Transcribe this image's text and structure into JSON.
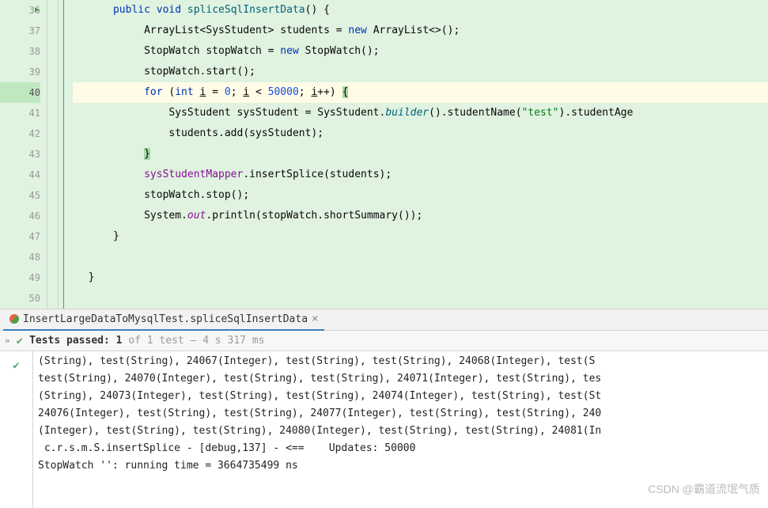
{
  "editor": {
    "lines": [
      {
        "n": 36,
        "play": true
      },
      {
        "n": 37
      },
      {
        "n": 38
      },
      {
        "n": 39
      },
      {
        "n": 40,
        "current": true
      },
      {
        "n": 41
      },
      {
        "n": 42
      },
      {
        "n": 43
      },
      {
        "n": 44
      },
      {
        "n": 45
      },
      {
        "n": 46
      },
      {
        "n": 47
      },
      {
        "n": 48
      },
      {
        "n": 49
      },
      {
        "n": 50
      }
    ],
    "code": {
      "l36": {
        "kw1": "public",
        "kw2": "void",
        "method": "spliceSqlInsertData",
        "rest": "() {"
      },
      "l37": {
        "t1": "ArrayList<",
        "t2": "SysStudent",
        "t3": "> students = ",
        "kw": "new",
        "t4": " ArrayList<>();"
      },
      "l38": {
        "t1": "StopWatch stopWatch",
        "t2": " = ",
        "kw": "new",
        "t3": " StopWatch();"
      },
      "l39": {
        "t": "stopWatch.start();"
      },
      "l40": {
        "kw1": "for",
        "t1": " (",
        "kw2": "int",
        "t2": " ",
        "v1": "i",
        "t3": " = ",
        "n1": "0",
        "t4": "; ",
        "v2": "i",
        "t5": " < ",
        "n2": "50000",
        "t6": "; ",
        "v3": "i",
        "t7": "++) ",
        "brace": "{"
      },
      "l41": {
        "t1": "SysStudent sysStudent = SysStudent.",
        "ital": "builder",
        "t2": "().studentName(",
        "str": "\"test\"",
        "t3": ").studentAge"
      },
      "l42": {
        "t": "students.add(sysStudent);"
      },
      "l43": {
        "brace": "}"
      },
      "l44": {
        "field": "sysStudentMapper",
        "t": ".insertSplice(students);"
      },
      "l45": {
        "t": "stopWatch.stop();"
      },
      "l46": {
        "t1": "System.",
        "stat": "out",
        "t2": ".println(stopWatch.shortSummary());"
      },
      "l47": {
        "t": "}"
      },
      "l49": {
        "t": "}"
      }
    }
  },
  "tab": {
    "label": "InsertLargeDataToMysqlTest.spliceSqlInsertData",
    "close": "×"
  },
  "status": {
    "passed_label": "Tests passed: ",
    "passed_count": "1",
    "of_part": " of 1 test – 4 s 317 ms"
  },
  "console": {
    "l1": "(String), test(String), 24067(Integer), test(String), test(String), 24068(Integer), test(S",
    "l2": "test(String), 24070(Integer), test(String), test(String), 24071(Integer), test(String), tes",
    "l3": "(String), 24073(Integer), test(String), test(String), 24074(Integer), test(String), test(St",
    "l4": "24076(Integer), test(String), test(String), 24077(Integer), test(String), test(String), 240",
    "l5": "(Integer), test(String), test(String), 24080(Integer), test(String), test(String), 24081(In",
    "l6": " c.r.s.m.S.insertSplice - [debug,137] - <==    Updates: 50000",
    "l7": "StopWatch '': running time = 3664735499 ns"
  },
  "watermark": "CSDN @霸道流氓气质"
}
